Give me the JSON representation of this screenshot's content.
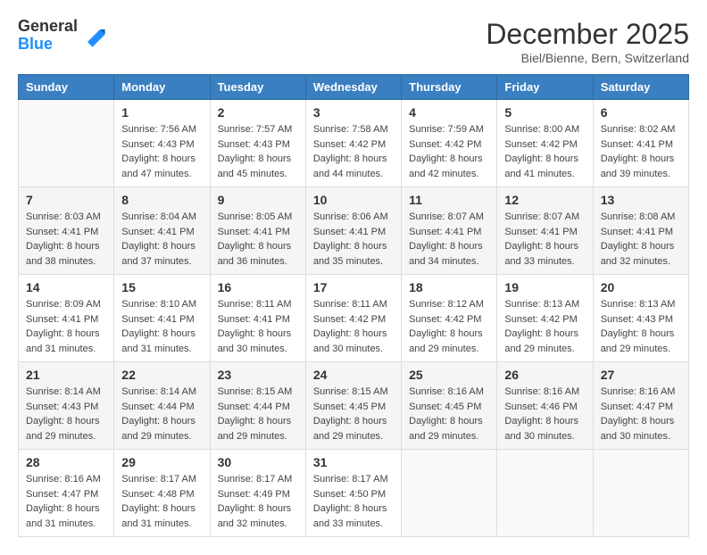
{
  "header": {
    "logo_general": "General",
    "logo_blue": "Blue",
    "month_title": "December 2025",
    "location": "Biel/Bienne, Bern, Switzerland"
  },
  "days_of_week": [
    "Sunday",
    "Monday",
    "Tuesday",
    "Wednesday",
    "Thursday",
    "Friday",
    "Saturday"
  ],
  "weeks": [
    [
      {
        "day": "",
        "sunrise": "",
        "sunset": "",
        "daylight": ""
      },
      {
        "day": "1",
        "sunrise": "Sunrise: 7:56 AM",
        "sunset": "Sunset: 4:43 PM",
        "daylight": "Daylight: 8 hours and 47 minutes."
      },
      {
        "day": "2",
        "sunrise": "Sunrise: 7:57 AM",
        "sunset": "Sunset: 4:43 PM",
        "daylight": "Daylight: 8 hours and 45 minutes."
      },
      {
        "day": "3",
        "sunrise": "Sunrise: 7:58 AM",
        "sunset": "Sunset: 4:42 PM",
        "daylight": "Daylight: 8 hours and 44 minutes."
      },
      {
        "day": "4",
        "sunrise": "Sunrise: 7:59 AM",
        "sunset": "Sunset: 4:42 PM",
        "daylight": "Daylight: 8 hours and 42 minutes."
      },
      {
        "day": "5",
        "sunrise": "Sunrise: 8:00 AM",
        "sunset": "Sunset: 4:42 PM",
        "daylight": "Daylight: 8 hours and 41 minutes."
      },
      {
        "day": "6",
        "sunrise": "Sunrise: 8:02 AM",
        "sunset": "Sunset: 4:41 PM",
        "daylight": "Daylight: 8 hours and 39 minutes."
      }
    ],
    [
      {
        "day": "7",
        "sunrise": "Sunrise: 8:03 AM",
        "sunset": "Sunset: 4:41 PM",
        "daylight": "Daylight: 8 hours and 38 minutes."
      },
      {
        "day": "8",
        "sunrise": "Sunrise: 8:04 AM",
        "sunset": "Sunset: 4:41 PM",
        "daylight": "Daylight: 8 hours and 37 minutes."
      },
      {
        "day": "9",
        "sunrise": "Sunrise: 8:05 AM",
        "sunset": "Sunset: 4:41 PM",
        "daylight": "Daylight: 8 hours and 36 minutes."
      },
      {
        "day": "10",
        "sunrise": "Sunrise: 8:06 AM",
        "sunset": "Sunset: 4:41 PM",
        "daylight": "Daylight: 8 hours and 35 minutes."
      },
      {
        "day": "11",
        "sunrise": "Sunrise: 8:07 AM",
        "sunset": "Sunset: 4:41 PM",
        "daylight": "Daylight: 8 hours and 34 minutes."
      },
      {
        "day": "12",
        "sunrise": "Sunrise: 8:07 AM",
        "sunset": "Sunset: 4:41 PM",
        "daylight": "Daylight: 8 hours and 33 minutes."
      },
      {
        "day": "13",
        "sunrise": "Sunrise: 8:08 AM",
        "sunset": "Sunset: 4:41 PM",
        "daylight": "Daylight: 8 hours and 32 minutes."
      }
    ],
    [
      {
        "day": "14",
        "sunrise": "Sunrise: 8:09 AM",
        "sunset": "Sunset: 4:41 PM",
        "daylight": "Daylight: 8 hours and 31 minutes."
      },
      {
        "day": "15",
        "sunrise": "Sunrise: 8:10 AM",
        "sunset": "Sunset: 4:41 PM",
        "daylight": "Daylight: 8 hours and 31 minutes."
      },
      {
        "day": "16",
        "sunrise": "Sunrise: 8:11 AM",
        "sunset": "Sunset: 4:41 PM",
        "daylight": "Daylight: 8 hours and 30 minutes."
      },
      {
        "day": "17",
        "sunrise": "Sunrise: 8:11 AM",
        "sunset": "Sunset: 4:42 PM",
        "daylight": "Daylight: 8 hours and 30 minutes."
      },
      {
        "day": "18",
        "sunrise": "Sunrise: 8:12 AM",
        "sunset": "Sunset: 4:42 PM",
        "daylight": "Daylight: 8 hours and 29 minutes."
      },
      {
        "day": "19",
        "sunrise": "Sunrise: 8:13 AM",
        "sunset": "Sunset: 4:42 PM",
        "daylight": "Daylight: 8 hours and 29 minutes."
      },
      {
        "day": "20",
        "sunrise": "Sunrise: 8:13 AM",
        "sunset": "Sunset: 4:43 PM",
        "daylight": "Daylight: 8 hours and 29 minutes."
      }
    ],
    [
      {
        "day": "21",
        "sunrise": "Sunrise: 8:14 AM",
        "sunset": "Sunset: 4:43 PM",
        "daylight": "Daylight: 8 hours and 29 minutes."
      },
      {
        "day": "22",
        "sunrise": "Sunrise: 8:14 AM",
        "sunset": "Sunset: 4:44 PM",
        "daylight": "Daylight: 8 hours and 29 minutes."
      },
      {
        "day": "23",
        "sunrise": "Sunrise: 8:15 AM",
        "sunset": "Sunset: 4:44 PM",
        "daylight": "Daylight: 8 hours and 29 minutes."
      },
      {
        "day": "24",
        "sunrise": "Sunrise: 8:15 AM",
        "sunset": "Sunset: 4:45 PM",
        "daylight": "Daylight: 8 hours and 29 minutes."
      },
      {
        "day": "25",
        "sunrise": "Sunrise: 8:16 AM",
        "sunset": "Sunset: 4:45 PM",
        "daylight": "Daylight: 8 hours and 29 minutes."
      },
      {
        "day": "26",
        "sunrise": "Sunrise: 8:16 AM",
        "sunset": "Sunset: 4:46 PM",
        "daylight": "Daylight: 8 hours and 30 minutes."
      },
      {
        "day": "27",
        "sunrise": "Sunrise: 8:16 AM",
        "sunset": "Sunset: 4:47 PM",
        "daylight": "Daylight: 8 hours and 30 minutes."
      }
    ],
    [
      {
        "day": "28",
        "sunrise": "Sunrise: 8:16 AM",
        "sunset": "Sunset: 4:47 PM",
        "daylight": "Daylight: 8 hours and 31 minutes."
      },
      {
        "day": "29",
        "sunrise": "Sunrise: 8:17 AM",
        "sunset": "Sunset: 4:48 PM",
        "daylight": "Daylight: 8 hours and 31 minutes."
      },
      {
        "day": "30",
        "sunrise": "Sunrise: 8:17 AM",
        "sunset": "Sunset: 4:49 PM",
        "daylight": "Daylight: 8 hours and 32 minutes."
      },
      {
        "day": "31",
        "sunrise": "Sunrise: 8:17 AM",
        "sunset": "Sunset: 4:50 PM",
        "daylight": "Daylight: 8 hours and 33 minutes."
      },
      {
        "day": "",
        "sunrise": "",
        "sunset": "",
        "daylight": ""
      },
      {
        "day": "",
        "sunrise": "",
        "sunset": "",
        "daylight": ""
      },
      {
        "day": "",
        "sunrise": "",
        "sunset": "",
        "daylight": ""
      }
    ]
  ]
}
